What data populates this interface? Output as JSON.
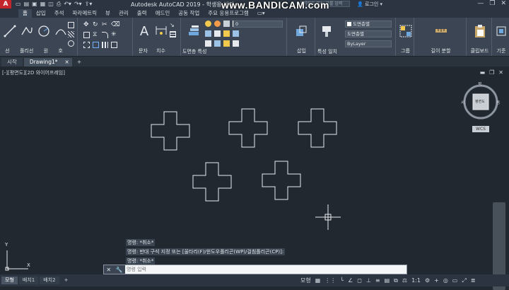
{
  "app": {
    "title": "Autodesk AutoCAD 2019 - 학생용 버전",
    "logo": "A",
    "watermark": "www.BANDICAM.com",
    "search_placeholder": "키워드 또는 구를 입력",
    "user": "로그인",
    "window_controls": [
      "—",
      "❐",
      "✕"
    ]
  },
  "menu": {
    "tabs": [
      "홈",
      "삽입",
      "주석",
      "파라메트릭",
      "뷰",
      "관리",
      "출력",
      "애드인",
      "공동 작업",
      "주요 응용프로그램"
    ],
    "toggle": "▭▾"
  },
  "ribbon": {
    "draw_labels": [
      "선",
      "폴리선",
      "원",
      "호"
    ],
    "modify_label": "",
    "annotation_labels": [
      "문자",
      "치수"
    ],
    "layer_props_label": "도면층 특성",
    "layer_value": "0",
    "insert_label": "삽입",
    "match_props_label": "특성 일치",
    "byLayer_color": "도면층별",
    "byLayer_lineweight": "도면층별",
    "byLayer_linetype": "ByLayer",
    "group_label": "그룹",
    "utility_label": "길이 분할",
    "clipboard_label": "클립보드",
    "base_label": "기준"
  },
  "doc_tabs": {
    "tabs": [
      "시작",
      "Drawing1*"
    ],
    "plus": "+"
  },
  "viewport": {
    "label": "[-][평면도][2D 와이어프레임]",
    "viewcube_top": "평면도",
    "viewcube_n": "북",
    "viewcube_w": "서",
    "viewcube_e": "동",
    "wcs": "WCS",
    "ucs_x": "X",
    "ucs_y": "Y"
  },
  "command": {
    "history": [
      "명령: *취소*",
      "명령: 반대 구석 지정 또는 [울타리(F)/윈도우폴리곤(WP)/걸침폴리곤(CP)]:",
      "명령: *취소*"
    ],
    "input_prompt": "명령 입력"
  },
  "status": {
    "layout_tabs": [
      "모형",
      "배치1",
      "배치2"
    ],
    "plus": "+",
    "model_label": "모형",
    "scale": "1:1"
  },
  "colors": {
    "accent": "#c4262e",
    "background": "#212830",
    "ribbon": "#3b4553"
  }
}
